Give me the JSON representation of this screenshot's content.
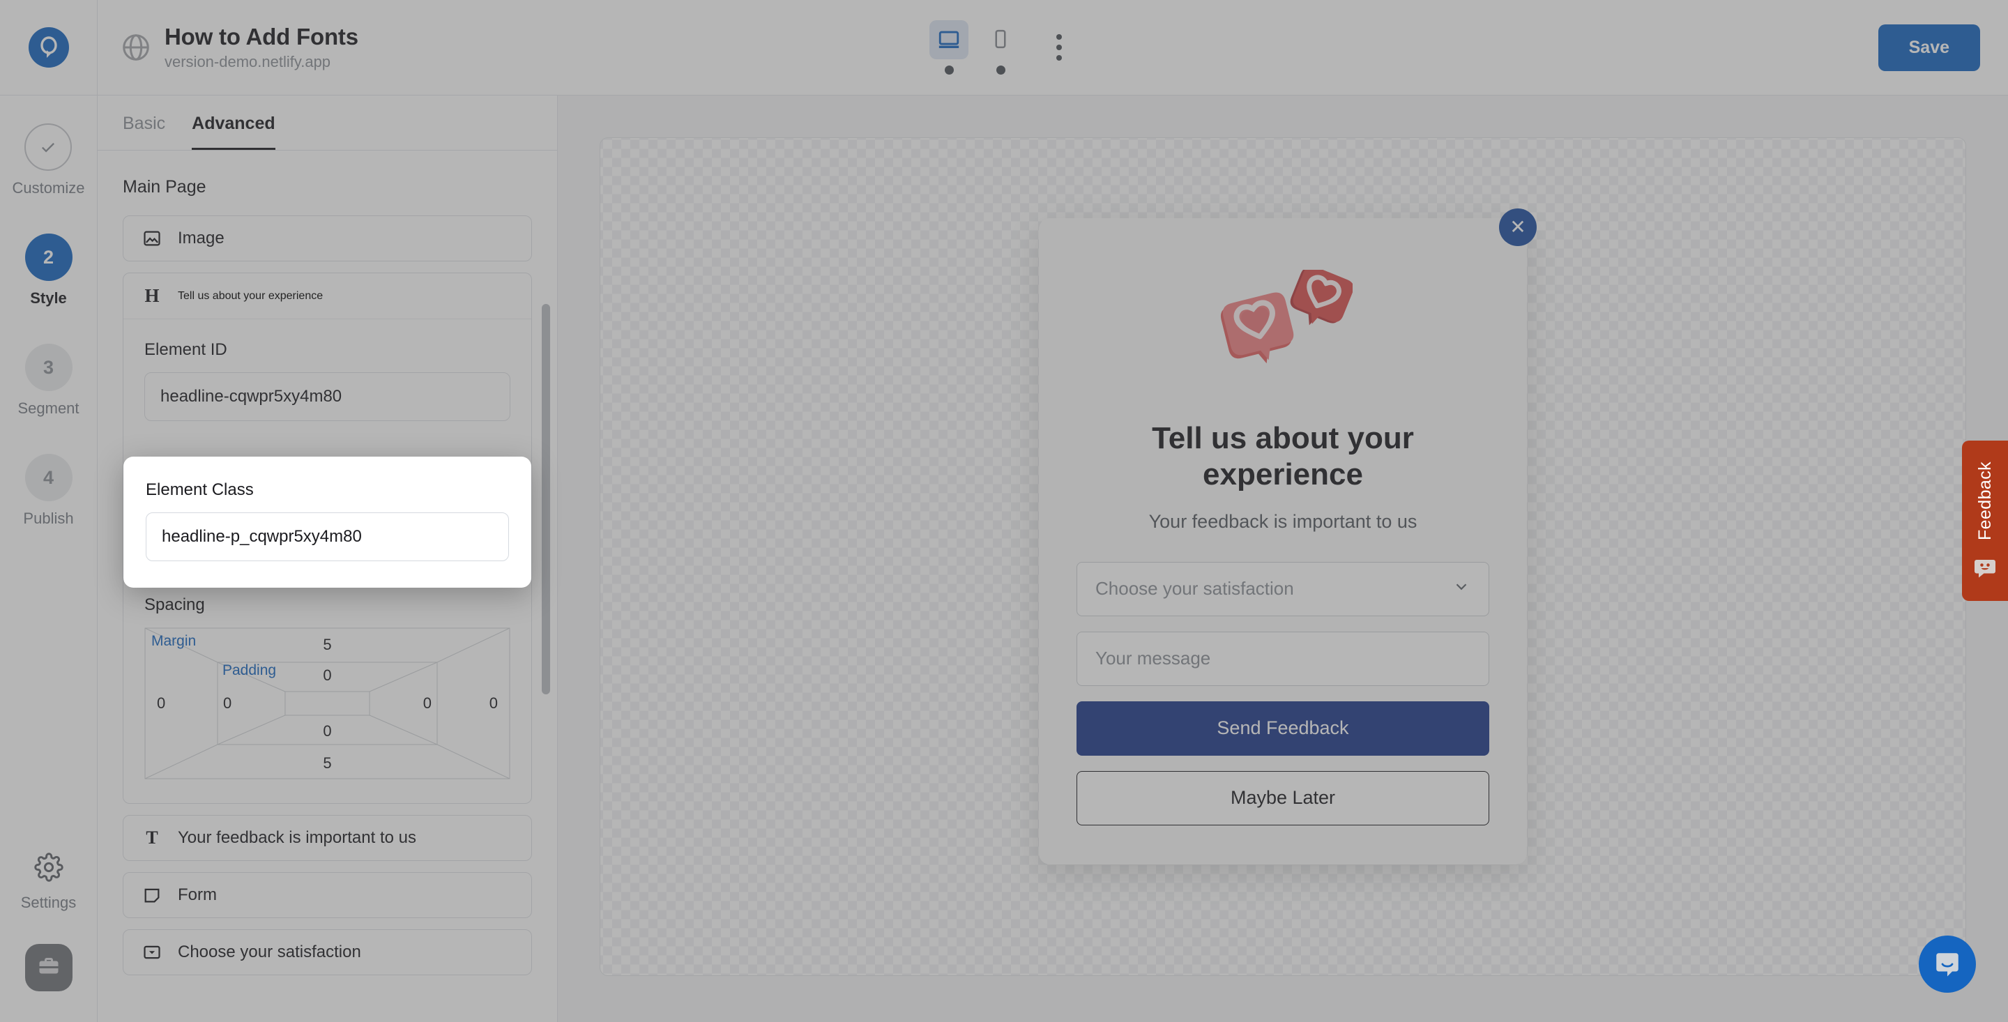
{
  "header": {
    "logo_icon": "popupsmart-logo-icon",
    "globe_icon": "globe-icon",
    "title": "How to Add Fonts",
    "url": "version-demo.netlify.app",
    "desktop_icon": "desktop-monitor-icon",
    "mobile_icon": "mobile-phone-icon",
    "kebab_icon": "more-vertical-icon",
    "save_label": "Save"
  },
  "rail": {
    "items": [
      {
        "badge": "✓",
        "label": "Customize",
        "state": "done",
        "icon": "check-icon"
      },
      {
        "badge": "2",
        "label": "Style",
        "state": "active",
        "icon": ""
      },
      {
        "badge": "3",
        "label": "Segment",
        "state": "idle",
        "icon": ""
      },
      {
        "badge": "4",
        "label": "Publish",
        "state": "idle",
        "icon": ""
      }
    ],
    "settings_label": "Settings",
    "settings_icon": "gear-icon",
    "avatar_icon": "briefcase-icon"
  },
  "panel": {
    "tabs": [
      {
        "label": "Basic",
        "active": false
      },
      {
        "label": "Advanced",
        "active": true
      }
    ],
    "section_title": "Main Page",
    "items": [
      {
        "label": "Image",
        "icon": "image-icon"
      },
      {
        "label": "Tell us about your experience",
        "icon": "heading-h-icon"
      },
      {
        "label": "Your feedback is important to us",
        "icon": "text-t-icon"
      },
      {
        "label": "Form",
        "icon": "form-icon"
      },
      {
        "label": "Choose your satisfaction",
        "icon": "select-dropdown-icon"
      }
    ],
    "element_id": {
      "label": "Element ID",
      "value": "headline-cqwpr5xy4m80"
    },
    "element_class": {
      "label": "Element Class",
      "value": "headline-p_cqwpr5xy4m80"
    },
    "spacing": {
      "label": "Spacing",
      "margin_tag": "Margin",
      "padding_tag": "Padding",
      "margin_top": "5",
      "margin_right": "0",
      "margin_bottom": "5",
      "margin_left": "0",
      "padding_top": "0",
      "padding_right": "0",
      "padding_bottom": "0",
      "padding_left": "0"
    }
  },
  "preview": {
    "close_icon": "close-x-icon",
    "art_icon": "heart-speech-bubbles-icon",
    "heading": "Tell us about your experience",
    "subheading": "Your feedback is important to us",
    "select_placeholder": "Choose your satisfaction",
    "select_chevron_icon": "chevron-down-icon",
    "message_placeholder": "Your message",
    "primary_button": "Send Feedback",
    "secondary_button": "Maybe Later"
  },
  "feedback_tab": {
    "label": "Feedback",
    "icon": "smiley-chat-icon"
  },
  "chat": {
    "icon": "chat-bubble-icon"
  },
  "colors": {
    "brand_blue": "#1565c0",
    "modal_primary": "#1e3a8a",
    "feedback_rust": "#b03a1a",
    "spacing_tag_blue": "#1565c0"
  }
}
